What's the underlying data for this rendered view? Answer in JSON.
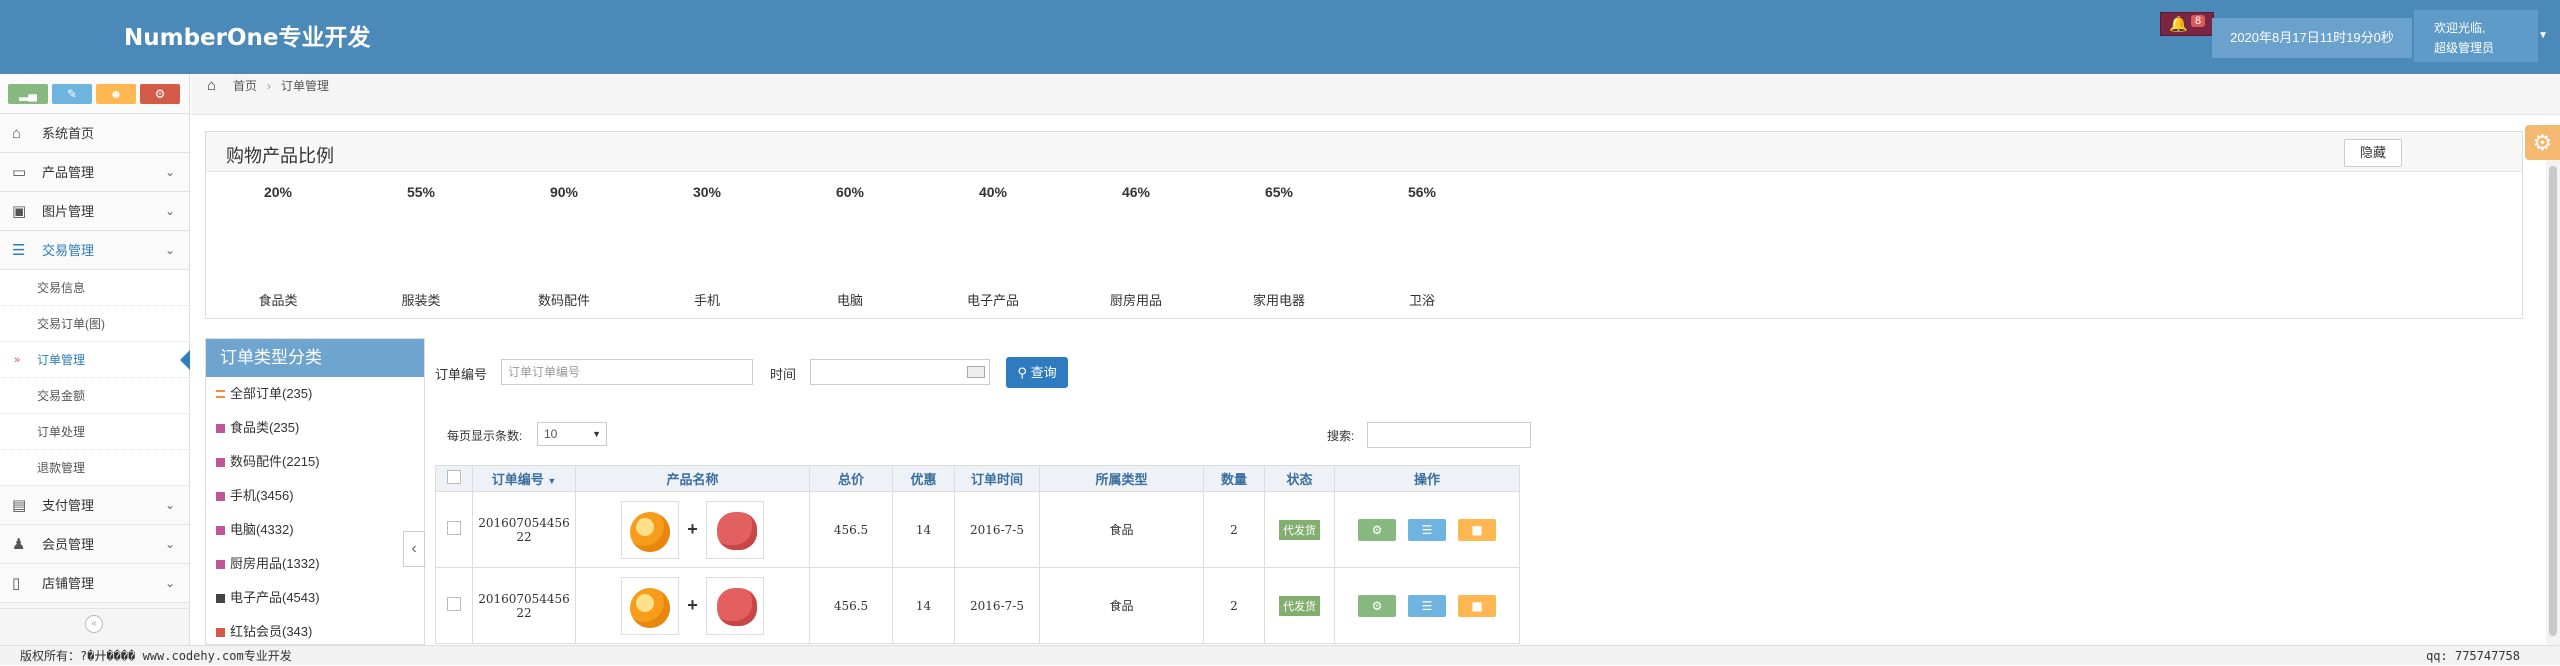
{
  "header": {
    "brand": "NumberOne专业开发",
    "notif_count": "8",
    "datetime": "2020年8月17日11时19分0秒",
    "welcome": "欢迎光临,",
    "role": "超级管理员"
  },
  "sidebar": {
    "shortcuts": [
      {
        "icon": "signal-icon",
        "color": "#87b87f"
      },
      {
        "icon": "pencil-icon",
        "color": "#6fb3e0"
      },
      {
        "icon": "users-icon",
        "color": "#ffb752"
      },
      {
        "icon": "cogs-icon",
        "color": "#d15b47"
      }
    ],
    "items": [
      {
        "label": "系统首页",
        "icon": "home-icon"
      },
      {
        "label": "产品管理",
        "icon": "desktop-icon"
      },
      {
        "label": "图片管理",
        "icon": "picture-icon"
      },
      {
        "label": "交易管理",
        "icon": "list-icon"
      }
    ],
    "subitems": [
      "交易信息",
      "交易订单(图)",
      "订单管理",
      "交易金额",
      "订单处理",
      "退款管理"
    ],
    "items_after": [
      {
        "label": "支付管理",
        "icon": "credit-card-icon"
      },
      {
        "label": "会员管理",
        "icon": "user-icon"
      },
      {
        "label": "店铺管理",
        "icon": "laptop-icon"
      }
    ],
    "collapse_glyph": "«"
  },
  "breadcrumb": {
    "home": "首页",
    "current": "订单管理"
  },
  "ratio_panel": {
    "title": "购物产品比例",
    "hide_label": "隐藏",
    "items": [
      {
        "pct": "20%",
        "label": "食品类"
      },
      {
        "pct": "55%",
        "label": "服装类"
      },
      {
        "pct": "90%",
        "label": "数码配件"
      },
      {
        "pct": "30%",
        "label": "手机"
      },
      {
        "pct": "60%",
        "label": "电脑"
      },
      {
        "pct": "40%",
        "label": "电子产品"
      },
      {
        "pct": "46%",
        "label": "厨房用品"
      },
      {
        "pct": "65%",
        "label": "家用电器"
      },
      {
        "pct": "56%",
        "label": "卫浴"
      }
    ]
  },
  "categories": {
    "title": "订单类型分类",
    "items": [
      {
        "label": "全部订单(235)",
        "color": "#ff8a3a"
      },
      {
        "label": "食品类(235)",
        "color": "#c0569a"
      },
      {
        "label": "数码配件(2215)",
        "color": "#c0569a"
      },
      {
        "label": "手机(3456)",
        "color": "#c0569a"
      },
      {
        "label": "电脑(4332)",
        "color": "#c0569a"
      },
      {
        "label": "厨房用品(1332)",
        "color": "#c0569a"
      },
      {
        "label": "电子产品(4543)",
        "color": "#444444"
      },
      {
        "label": "红钻会员(343)",
        "color": "#d15b47"
      }
    ]
  },
  "search": {
    "order_no_label": "订单编号",
    "order_no_placeholder": "订单订单编号",
    "time_label": "时间",
    "query_label": "查询",
    "page_size_label": "每页显示条数:",
    "page_size_value": "10",
    "search_label": "搜索:"
  },
  "table": {
    "headers": [
      "订单编号",
      "产品名称",
      "总价",
      "优惠",
      "订单时间",
      "所属类型",
      "数量",
      "状态",
      "操作"
    ],
    "rows": [
      {
        "order_no_1": "201607054456",
        "order_no_2": "22",
        "total": "456.5",
        "discount": "14",
        "date": "2016-7-5",
        "type": "食品",
        "qty": "2",
        "status": "代发货"
      },
      {
        "order_no_1": "201607054456",
        "order_no_2": "22",
        "total": "456.5",
        "discount": "14",
        "date": "2016-7-5",
        "type": "食品",
        "qty": "2",
        "status": "代发货"
      }
    ],
    "action_colors": [
      "#87b87f",
      "#6fb3e0",
      "#ffb752"
    ]
  },
  "footer": {
    "left": "版权所有：?�廾���� www.codehy.com专业开发",
    "right": "qq: 775747758"
  }
}
